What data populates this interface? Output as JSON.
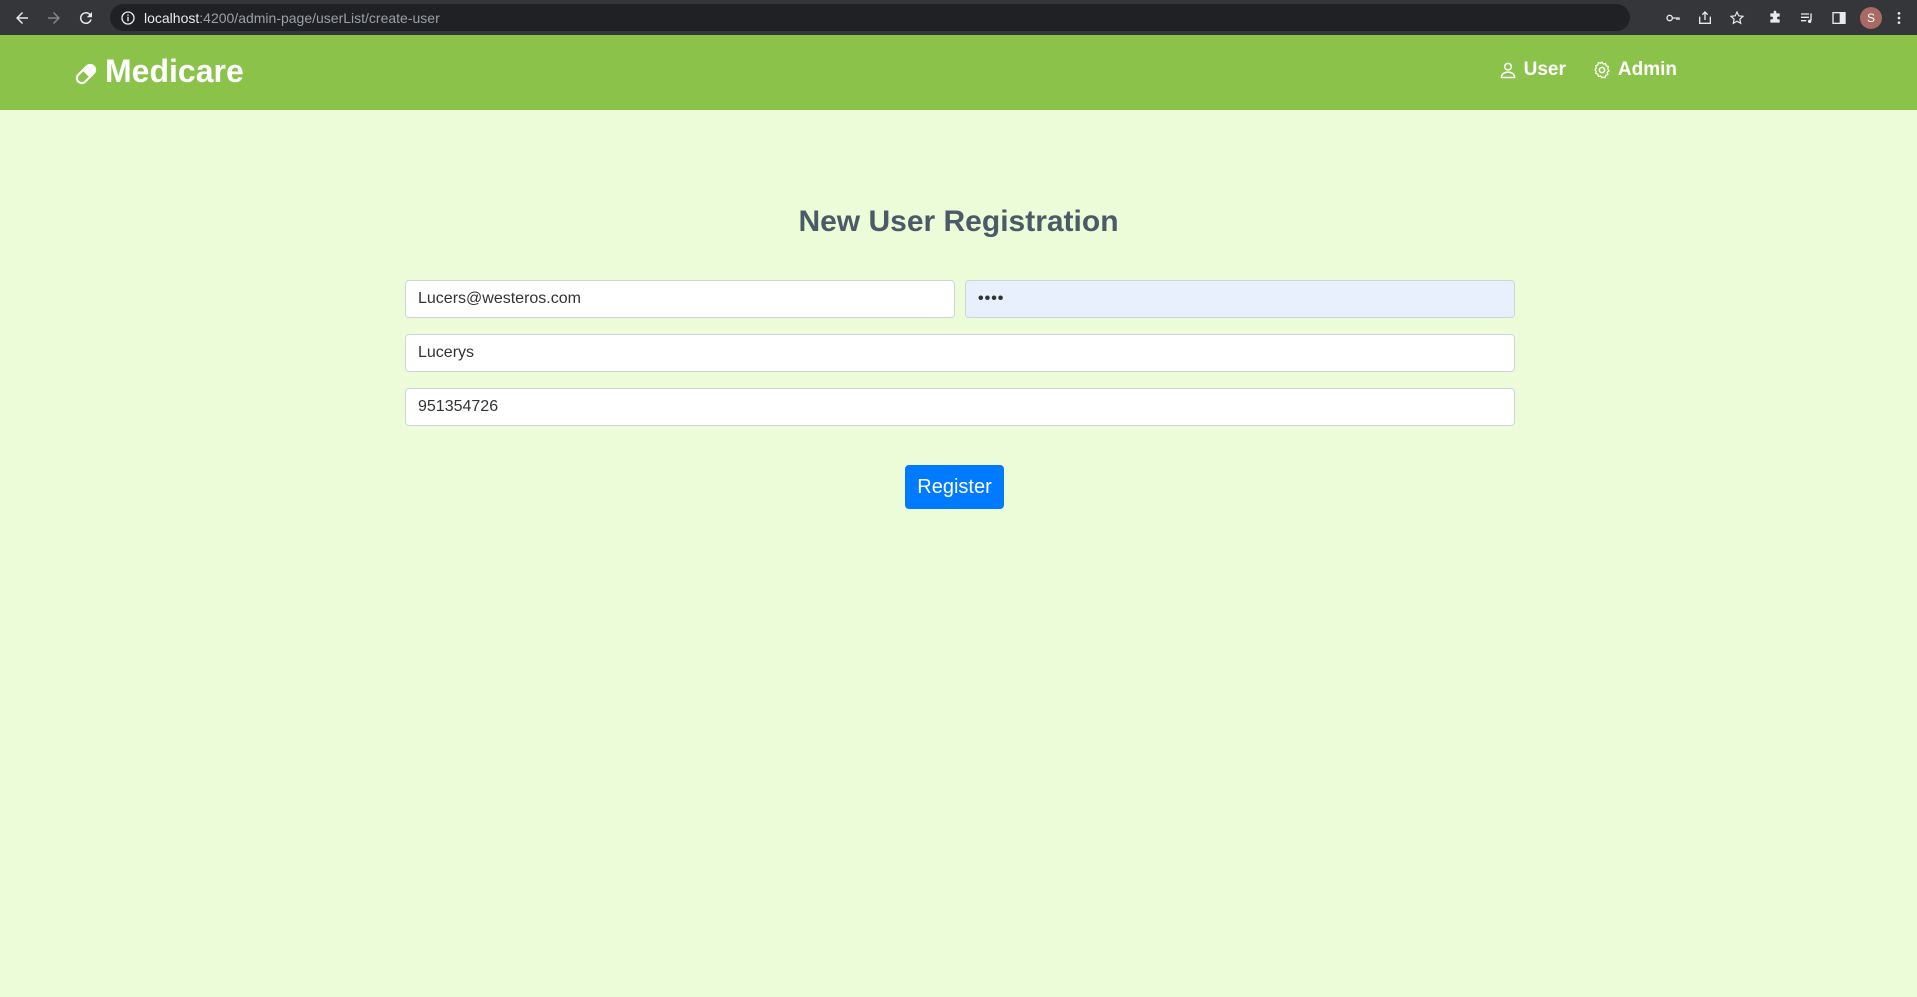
{
  "browser": {
    "url_host": "localhost",
    "url_path": ":4200/admin-page/userList/create-user",
    "profile_initial": "S"
  },
  "header": {
    "brand": "Medicare",
    "brand_icon": "pill-icon",
    "nav": [
      {
        "label": "User",
        "icon": "user-icon"
      },
      {
        "label": "Admin",
        "icon": "gear-icon"
      }
    ],
    "background_color": "#8bc34a"
  },
  "form": {
    "title": "New User Registration",
    "email_value": "Lucers@westeros.com",
    "password_value": "••••",
    "name_value": "Lucerys",
    "phone_value": "951354726",
    "submit_label": "Register"
  },
  "colors": {
    "page_background": "#ecfcd8",
    "primary_button": "#007bff",
    "title_text": "#4a5a66"
  }
}
